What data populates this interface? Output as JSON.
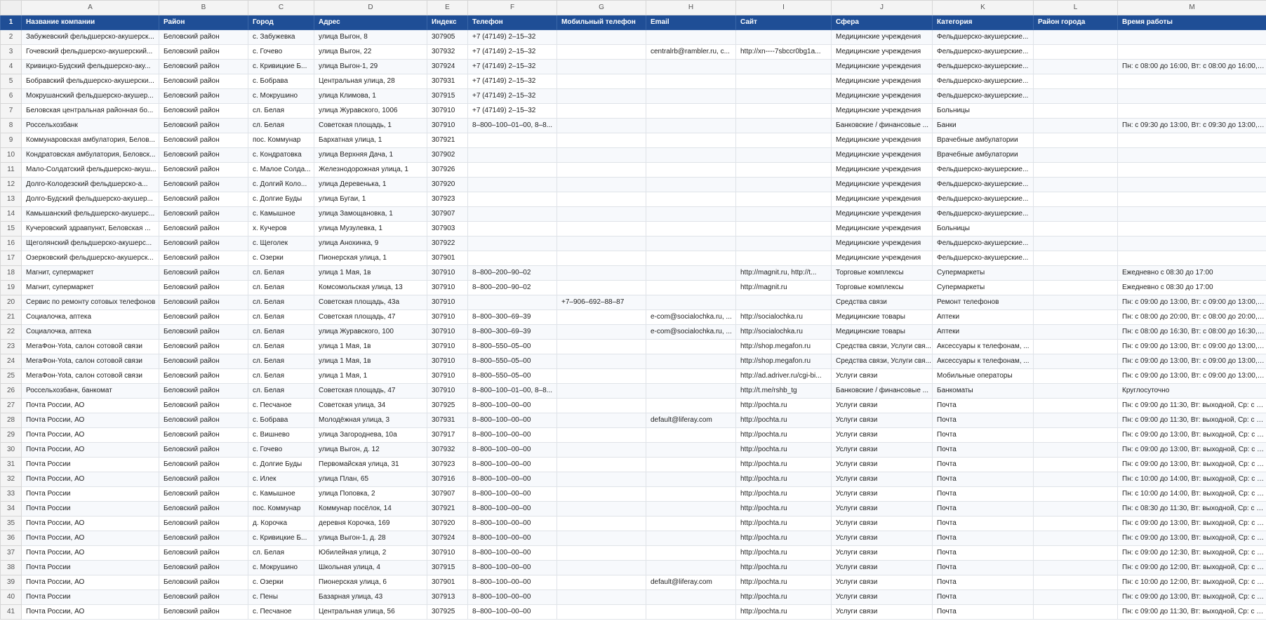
{
  "col_letters": [
    "A",
    "B",
    "C",
    "D",
    "E",
    "F",
    "G",
    "H",
    "I",
    "J",
    "K",
    "L",
    "M"
  ],
  "header_row_number": "1",
  "headers": [
    "Название компании",
    "Район",
    "Город",
    "Адрес",
    "Индекс",
    "Телефон",
    "Мобильный телефон",
    "Email",
    "Сайт",
    "Сфера",
    "Категория",
    "Район города",
    "Время работы"
  ],
  "rows": [
    [
      "2",
      "Забужевский фельдшерско-акушерск...",
      "Беловский район",
      "с. Забужевка",
      "улица Выгон, 8",
      "307905",
      "+7 (47149) 2–15–32",
      "",
      "",
      "",
      "Медицинские учреждения",
      "Фельдшерско-акушерские...",
      "",
      ""
    ],
    [
      "3",
      "Гочевский фельдшерско-акушерский...",
      "Беловский район",
      "с. Гочево",
      "улица Выгон, 22",
      "307932",
      "+7 (47149) 2–15–32",
      "",
      "centralrb@rambler.ru, c...",
      "http://xn----7sbccr0bg1a...",
      "Медицинские учреждения",
      "Фельдшерско-акушерские...",
      "",
      ""
    ],
    [
      "4",
      "Кривицко-Будский фельдшерско-аку...",
      "Беловский район",
      "с. Кривицкие Б...",
      "улица Выгон-1, 29",
      "307924",
      "+7 (47149) 2–15–32",
      "",
      "",
      "",
      "Медицинские учреждения",
      "Фельдшерско-акушерские...",
      "",
      "Пн: с 08:00 до 16:00, Вт: с 08:00 до 16:00, С..."
    ],
    [
      "5",
      "Бобравский фельдшерско-акушерски...",
      "Беловский район",
      "с. Бобрава",
      "Центральная улица, 28",
      "307931",
      "+7 (47149) 2–15–32",
      "",
      "",
      "",
      "Медицинские учреждения",
      "Фельдшерско-акушерские...",
      "",
      ""
    ],
    [
      "6",
      "Мокрушанский фельдшерско-акушер...",
      "Беловский район",
      "с. Мокрушино",
      "улица Климова, 1",
      "307915",
      "+7 (47149) 2–15–32",
      "",
      "",
      "",
      "Медицинские учреждения",
      "Фельдшерско-акушерские...",
      "",
      ""
    ],
    [
      "7",
      "Беловская центральная районная бо...",
      "Беловский район",
      "сл. Белая",
      "улица Журавского, 1006",
      "307910",
      "+7 (47149) 2–15–32",
      "",
      "",
      "",
      "Медицинские учреждения",
      "Больницы",
      "",
      ""
    ],
    [
      "8",
      "Россельхозбанк",
      "Беловский район",
      "сл. Белая",
      "Советская площадь, 1",
      "307910",
      "8–800–100–01–00, 8–8...",
      "",
      "",
      "",
      "Банковские / финансовые ...",
      "Банки",
      "",
      "Пн: с 09:30 до 13:00, Вт: с 09:30 до 13:00, С..."
    ],
    [
      "9",
      "Коммунаровская амбулатория, Белов...",
      "Беловский район",
      "пос. Коммунар",
      "Бархатная улица, 1",
      "307921",
      "",
      "",
      "",
      "",
      "Медицинские учреждения",
      "Врачебные амбулатории",
      "",
      ""
    ],
    [
      "10",
      "Кондратовская амбулатория, Беловск...",
      "Беловский район",
      "с. Кондратовка",
      "улица Верхняя Дача, 1",
      "307902",
      "",
      "",
      "",
      "",
      "Медицинские учреждения",
      "Врачебные амбулатории",
      "",
      ""
    ],
    [
      "11",
      "Мало-Солдатский фельдшерско-акуш...",
      "Беловский район",
      "с. Малое Солда...",
      "Железнодорожная улица, 1",
      "307926",
      "",
      "",
      "",
      "",
      "Медицинские учреждения",
      "Фельдшерско-акушерские...",
      "",
      ""
    ],
    [
      "12",
      "Долго-Колодезский фельдшерско-а...",
      "Беловский район",
      "с. Долгий Коло...",
      "улица Деревенька, 1",
      "307920",
      "",
      "",
      "",
      "",
      "Медицинские учреждения",
      "Фельдшерско-акушерские...",
      "",
      ""
    ],
    [
      "13",
      "Долго-Будский фельдшерско-акушер...",
      "Беловский район",
      "с. Долгие Буды",
      "улица Бугаи, 1",
      "307923",
      "",
      "",
      "",
      "",
      "Медицинские учреждения",
      "Фельдшерско-акушерские...",
      "",
      ""
    ],
    [
      "14",
      "Камышанский фельдшерско-акушерс...",
      "Беловский район",
      "с. Камышное",
      "улица Замощановка, 1",
      "307907",
      "",
      "",
      "",
      "",
      "Медицинские учреждения",
      "Фельдшерско-акушерские...",
      "",
      ""
    ],
    [
      "15",
      "Кучеровский здравпункт, Беловская ...",
      "Беловский район",
      "х. Кучеров",
      "улица Музулевка, 1",
      "307903",
      "",
      "",
      "",
      "",
      "Медицинские учреждения",
      "Больницы",
      "",
      ""
    ],
    [
      "16",
      "Щеголянский фельдшерско-акушерс...",
      "Беловский район",
      "с. Щеголек",
      "улица Анохинка, 9",
      "307922",
      "",
      "",
      "",
      "",
      "Медицинские учреждения",
      "Фельдшерско-акушерские...",
      "",
      ""
    ],
    [
      "17",
      "Озерковский фельдшерско-акушерск...",
      "Беловский район",
      "с. Озерки",
      "Пионерская улица, 1",
      "307901",
      "",
      "",
      "",
      "",
      "Медицинские учреждения",
      "Фельдшерско-акушерские...",
      "",
      ""
    ],
    [
      "18",
      "Магнит, супермаркет",
      "Беловский район",
      "сл. Белая",
      "улица 1 Мая, 1в",
      "307910",
      "8–800–200–90–02",
      "",
      "",
      "http://magnit.ru, http://t...",
      "Торговые комплексы",
      "Супермаркеты",
      "",
      "Ежедневно с 08:30 до 17:00"
    ],
    [
      "19",
      "Магнит, супермаркет",
      "Беловский район",
      "сл. Белая",
      "Комсомольская улица, 13",
      "307910",
      "8–800–200–90–02",
      "",
      "",
      "http://magnit.ru",
      "Торговые комплексы",
      "Супермаркеты",
      "",
      "Ежедневно с 08:30 до 17:00"
    ],
    [
      "20",
      "Сервис по ремонту сотовых телефонов",
      "Беловский район",
      "сл. Белая",
      "Советская площадь, 43а",
      "307910",
      "",
      "+7–906–692–88–87",
      "",
      "",
      "Средства связи",
      "Ремонт телефонов",
      "",
      "Пн: с 09:00 до 13:00, Вт: с 09:00 до 13:00, С..."
    ],
    [
      "21",
      "Социалочка, аптека",
      "Беловский район",
      "сл. Белая",
      "Советская площадь, 47",
      "307910",
      "8–800–300–69–39",
      "",
      "e-com@socialochka.ru, ...",
      "http://socialochka.ru",
      "Медицинские товары",
      "Аптеки",
      "",
      "Пн: с 08:00 до 20:00, Вт: с 08:00 до 20:00, С..."
    ],
    [
      "22",
      "Социалочка, аптека",
      "Беловский район",
      "сл. Белая",
      "улица Журавского, 100",
      "307910",
      "8–800–300–69–39",
      "",
      "e-com@socialochka.ru, ...",
      "http://socialochka.ru",
      "Медицинские товары",
      "Аптеки",
      "",
      "Пн: с 08:00 до 16:30, Вт: с 08:00 до 16:30, С..."
    ],
    [
      "23",
      "МегаФон-Yota, салон сотовой связи",
      "Беловский район",
      "сл. Белая",
      "улица 1 Мая, 1в",
      "307910",
      "8–800–550–05–00",
      "",
      "",
      "http://shop.megafon.ru",
      "Средства связи, Услуги свя...",
      "Аксессуары к телефонам, ...",
      "",
      "Пн: с 09:00 до 13:00, Вт: с 09:00 до 13:00, С..."
    ],
    [
      "24",
      "МегаФон-Yota, салон сотовой связи",
      "Беловский район",
      "сл. Белая",
      "улица 1 Мая, 1в",
      "307910",
      "8–800–550–05–00",
      "",
      "",
      "http://shop.megafon.ru",
      "Средства связи, Услуги свя...",
      "Аксессуары к телефонам, ...",
      "",
      "Пн: с 09:00 до 13:00, Вт: с 09:00 до 13:00, С..."
    ],
    [
      "25",
      "МегаФон-Yota, салон сотовой связи",
      "Беловский район",
      "сл. Белая",
      "улица 1 Мая, 1",
      "307910",
      "8–800–550–05–00",
      "",
      "",
      "http://ad.adriver.ru/cgi-bi...",
      "Услуги связи",
      "Мобильные операторы",
      "",
      "Пн: с 09:00 до 13:00, Вт: с 09:00 до 13:00, С..."
    ],
    [
      "26",
      "Россельхозбанк, банкомат",
      "Беловский район",
      "сл. Белая",
      "Советская площадь, 47",
      "307910",
      "8–800–100–01–00, 8–8...",
      "",
      "",
      "http://t.me/rshb_tg",
      "Банковские / финансовые ...",
      "Банкоматы",
      "",
      "Круглосуточно"
    ],
    [
      "27",
      "Почта России, АО",
      "Беловский район",
      "с. Песчаное",
      "Советская улица, 34",
      "307925",
      "8–800–100–00–00",
      "",
      "",
      "http://pochta.ru",
      "Услуги связи",
      "Почта",
      "",
      "Пн: с 09:00 до 11:30, Вт: выходной, Ср: с 0..."
    ],
    [
      "28",
      "Почта России, АО",
      "Беловский район",
      "с. Бобрава",
      "Молодёжная улица, 3",
      "307931",
      "8–800–100–00–00",
      "",
      "default@liferay.com",
      "http://pochta.ru",
      "Услуги связи",
      "Почта",
      "",
      "Пн: с 09:00 до 11:30, Вт: выходной, Ср: с 0..."
    ],
    [
      "29",
      "Почта России, АО",
      "Беловский район",
      "с. Вишнево",
      "улица Загороднева, 10а",
      "307917",
      "8–800–100–00–00",
      "",
      "",
      "http://pochta.ru",
      "Услуги связи",
      "Почта",
      "",
      "Пн: с 09:00 до 13:00, Вт: выходной, Ср: с 0..."
    ],
    [
      "30",
      "Почта России, АО",
      "Беловский район",
      "с. Гочево",
      "улица Выгон, д. 12",
      "307932",
      "8–800–100–00–00",
      "",
      "",
      "http://pochta.ru",
      "Услуги связи",
      "Почта",
      "",
      "Пн: с 09:00 до 13:00, Вт: выходной, Ср: с 0..."
    ],
    [
      "31",
      "Почта России",
      "Беловский район",
      "с. Долгие Буды",
      "Первомайская улица, 31",
      "307923",
      "8–800–100–00–00",
      "",
      "",
      "http://pochta.ru",
      "Услуги связи",
      "Почта",
      "",
      "Пн: с 09:00 до 13:00, Вт: выходной, Ср: с 0..."
    ],
    [
      "32",
      "Почта России, АО",
      "Беловский район",
      "с. Илек",
      "улица План, 65",
      "307916",
      "8–800–100–00–00",
      "",
      "",
      "http://pochta.ru",
      "Услуги связи",
      "Почта",
      "",
      "Пн: с 10:00 до 14:00, Вт: выходной, Ср: с 1..."
    ],
    [
      "33",
      "Почта России",
      "Беловский район",
      "с. Камышное",
      "улица Поповка, 2",
      "307907",
      "8–800–100–00–00",
      "",
      "",
      "http://pochta.ru",
      "Услуги связи",
      "Почта",
      "",
      "Пн: с 10:00 до 14:00, Вт: выходной, Ср: с 1..."
    ],
    [
      "34",
      "Почта России",
      "Беловский район",
      "пос. Коммунар",
      "Коммунар посёлок, 14",
      "307921",
      "8–800–100–00–00",
      "",
      "",
      "http://pochta.ru",
      "Услуги связи",
      "Почта",
      "",
      "Пн: с 08:30 до 11:30, Вт: выходной, Ср: с 0..."
    ],
    [
      "35",
      "Почта России, АО",
      "Беловский район",
      "д. Корочка",
      "деревня Корочка, 169",
      "307920",
      "8–800–100–00–00",
      "",
      "",
      "http://pochta.ru",
      "Услуги связи",
      "Почта",
      "",
      "Пн: с 09:00 до 13:00, Вт: выходной, Ср: с 0..."
    ],
    [
      "36",
      "Почта России, АО",
      "Беловский район",
      "с. Кривицкие Б...",
      "улица Выгон-1, д. 28",
      "307924",
      "8–800–100–00–00",
      "",
      "",
      "http://pochta.ru",
      "Услуги связи",
      "Почта",
      "",
      "Пн: с 09:00 до 13:00, Вт: выходной, Ср: с 0..."
    ],
    [
      "37",
      "Почта России, АО",
      "Беловский район",
      "сл. Белая",
      "Юбилейная улица, 2",
      "307910",
      "8–800–100–00–00",
      "",
      "",
      "http://pochta.ru",
      "Услуги связи",
      "Почта",
      "",
      "Пн: с 09:00 до 12:30, Вт: выходной, Ср: с 0..."
    ],
    [
      "38",
      "Почта России",
      "Беловский район",
      "с. Мокрушино",
      "Школьная улица, 4",
      "307915",
      "8–800–100–00–00",
      "",
      "",
      "http://pochta.ru",
      "Услуги связи",
      "Почта",
      "",
      "Пн: с 09:00 до 12:00, Вт: выходной, Ср: с 0..."
    ],
    [
      "39",
      "Почта России, АО",
      "Беловский район",
      "с. Озерки",
      "Пионерская улица, 6",
      "307901",
      "8–800–100–00–00",
      "",
      "default@liferay.com",
      "http://pochta.ru",
      "Услуги связи",
      "Почта",
      "",
      "Пн: с 10:00 до 12:00, Вт: выходной, Ср: с 1..."
    ],
    [
      "40",
      "Почта России",
      "Беловский район",
      "с. Пены",
      "Базарная улица, 43",
      "307913",
      "8–800–100–00–00",
      "",
      "",
      "http://pochta.ru",
      "Услуги связи",
      "Почта",
      "",
      "Пн: с 09:00 до 13:00, Вт: выходной, Ср: с 0..."
    ],
    [
      "41",
      "Почта России, АО",
      "Беловский район",
      "с. Песчаное",
      "Центральная улица, 56",
      "307925",
      "8–800–100–00–00",
      "",
      "",
      "http://pochta.ru",
      "Услуги связи",
      "Почта",
      "",
      "Пн: с 09:00 до 11:30, Вт: выходной, Ср: с 0..."
    ]
  ]
}
